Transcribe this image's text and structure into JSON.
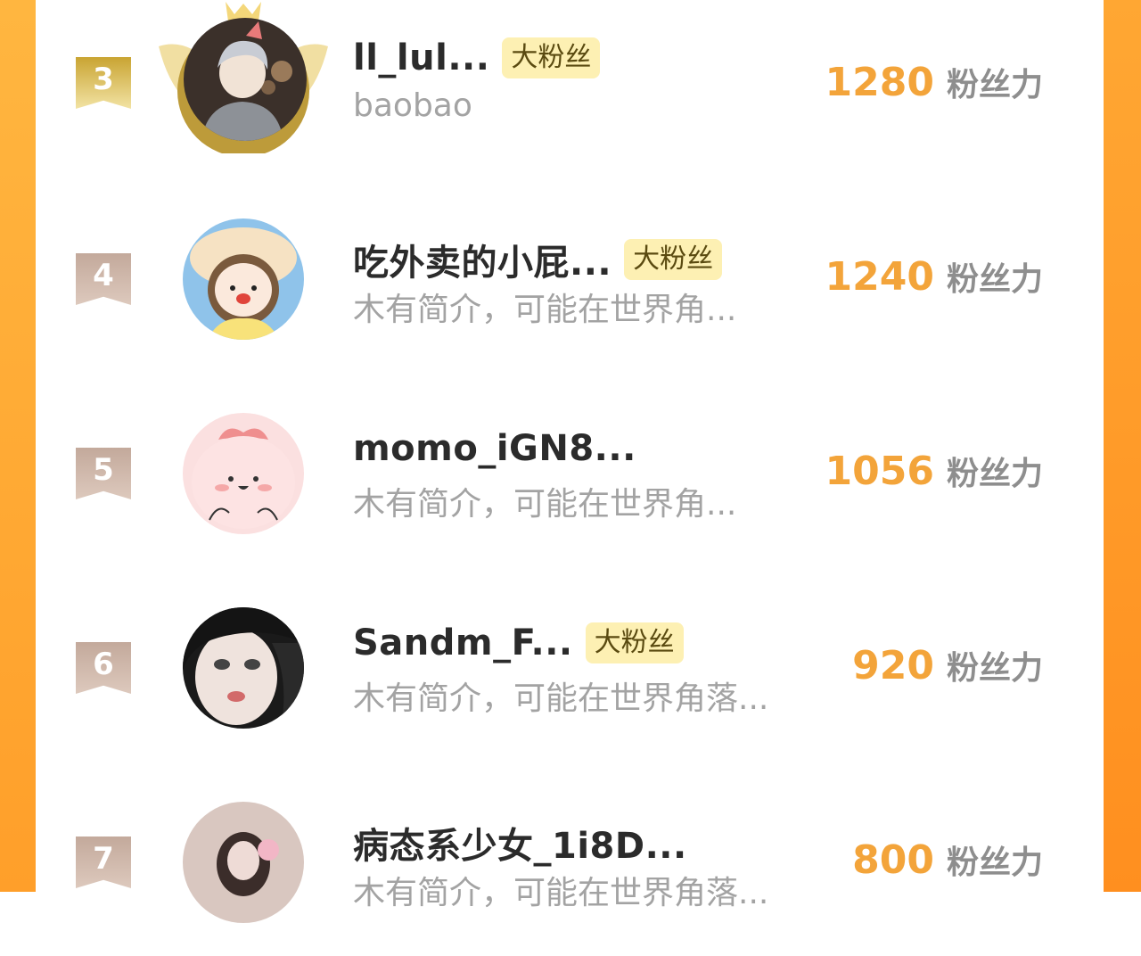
{
  "fan_unit": "粉丝力",
  "badge_label": "大粉丝",
  "rows": [
    {
      "rank": "3",
      "name": "ll_lul...",
      "badge": "大粉丝",
      "desc": "baobao",
      "score": "1280"
    },
    {
      "rank": "4",
      "name": "吃外卖的小屁...",
      "badge": "大粉丝",
      "desc": "木有简介，可能在世界角...",
      "score": "1240"
    },
    {
      "rank": "5",
      "name": "momo_iGN8...",
      "badge": "",
      "desc": "木有简介，可能在世界角...",
      "score": "1056"
    },
    {
      "rank": "6",
      "name": "Sandm_F...",
      "badge": "大粉丝",
      "desc": "木有简介，可能在世界角落...",
      "score": "920"
    },
    {
      "rank": "7",
      "name": "病态系少女_1i8D...",
      "badge": "",
      "desc": "木有简介，可能在世界角落...",
      "score": "800"
    }
  ],
  "colors": {
    "accent": "#f3a43a",
    "side": "#ffa733",
    "badge_bg": "#fdf0b3"
  }
}
